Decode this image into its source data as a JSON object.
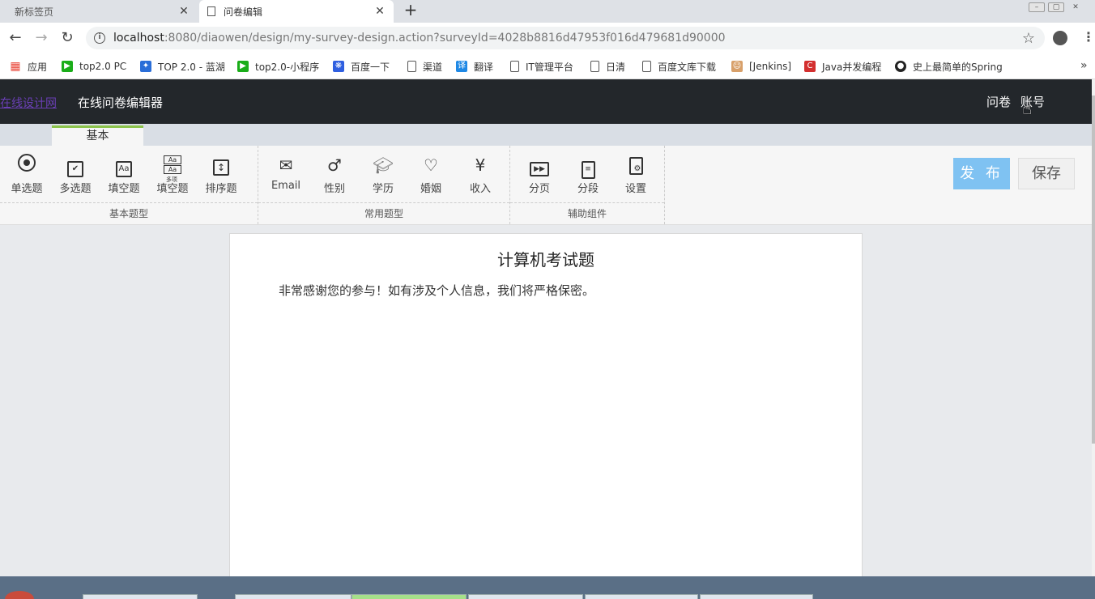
{
  "browser": {
    "tabs": [
      {
        "title": "新标签页",
        "active": false
      },
      {
        "title": "问卷编辑",
        "active": true
      }
    ],
    "url_host": "localhost",
    "url_rest": ":8080/diaowen/design/my-survey-design.action?surveyId=4028b8816d47953f016d479681d90000",
    "bookmarks": [
      {
        "label": "应用",
        "icon": "apps-grid-icon",
        "color": "#e94235"
      },
      {
        "label": "top2.0 PC",
        "icon": "play-icon",
        "color": "#1aad19"
      },
      {
        "label": "TOP 2.0 - 蓝湖",
        "icon": "lanhu-icon",
        "color": "#2a6ed8"
      },
      {
        "label": "top2.0-小程序",
        "icon": "play-icon",
        "color": "#1aad19"
      },
      {
        "label": "百度一下",
        "icon": "baidu-paw-icon",
        "color": "#2f5fe0"
      },
      {
        "label": "渠道",
        "icon": "page-icon",
        "color": "#ffffff"
      },
      {
        "label": "翻译",
        "icon": "translate-icon",
        "color": "#1e88e5"
      },
      {
        "label": "IT管理平台",
        "icon": "page-icon",
        "color": "#ffffff"
      },
      {
        "label": "日清",
        "icon": "page-icon",
        "color": "#ffffff"
      },
      {
        "label": "百度文库下载",
        "icon": "page-icon",
        "color": "#ffffff"
      },
      {
        "label": "[Jenkins]",
        "icon": "jenkins-icon",
        "color": "#d8a06a"
      },
      {
        "label": "Java并发编程",
        "icon": "c-logo-icon",
        "color": "#d32f2f"
      },
      {
        "label": "史上最简单的Spring",
        "icon": "github-icon",
        "color": "#222222"
      }
    ]
  },
  "header": {
    "brand": "在线设计网",
    "title": "在线问卷编辑器",
    "links": [
      "问卷",
      "账号"
    ]
  },
  "ribbon": {
    "tab": "基本",
    "groups": [
      {
        "label": "基本题型",
        "tools": [
          "单选题",
          "多选题",
          "填空题",
          "填空题",
          "排序题"
        ]
      },
      {
        "label": "常用题型",
        "tools": [
          "Email",
          "性别",
          "学历",
          "婚姻",
          "收入"
        ]
      },
      {
        "label": "辅助组件",
        "tools": [
          "分页",
          "分段",
          "设置"
        ]
      }
    ],
    "multi_fill_badge": "多项",
    "publish": "发 布",
    "save": "保存"
  },
  "survey": {
    "title": "计算机考试题",
    "intro": "非常感谢您的参与！如有涉及个人信息，我们将严格保密。"
  }
}
